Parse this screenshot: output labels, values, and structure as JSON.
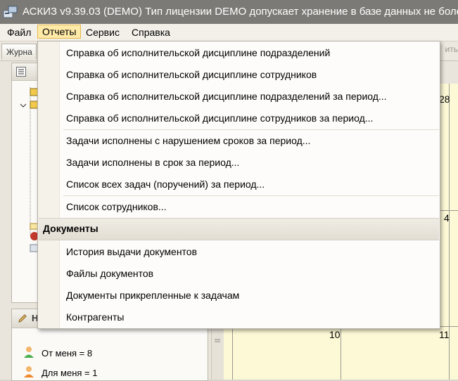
{
  "window": {
    "title": "АСКИЗ v9.39.03 (DEMO) Тип лицензии DEMO допускает хранение в базе данных не боле"
  },
  "menubar": {
    "items": [
      {
        "label": "Файл"
      },
      {
        "label": "Отчеты"
      },
      {
        "label": "Сервис"
      },
      {
        "label": "Справка"
      }
    ],
    "active": "Отчеты"
  },
  "background": {
    "tab_label": "Журна",
    "right_label": "ить",
    "lower_panel_header": "Н",
    "stats": [
      {
        "label": "От меня = 8"
      },
      {
        "label": "Для меня = 1"
      }
    ],
    "calendar_numbers": [
      "28",
      "4",
      "10",
      "11"
    ]
  },
  "dropdown": {
    "group1": [
      {
        "label": "Справка об исполнительской дисциплине подразделений"
      },
      {
        "label": "Справка об исполнительской дисциплине сотрудников"
      },
      {
        "label": "Справка об исполнительской дисциплине подразделений за период..."
      },
      {
        "label": "Справка об исполнительской дисциплине сотрудников за период..."
      }
    ],
    "group2": [
      {
        "label": "Задачи исполнены с нарушением сроков за период..."
      },
      {
        "label": "Задачи исполнены в срок за период..."
      },
      {
        "label": "Список всех задач (поручений) за период..."
      }
    ],
    "group3": [
      {
        "label": "Список сотрудников..."
      }
    ],
    "section_header": "Документы",
    "group4": [
      {
        "label": "История выдачи документов"
      },
      {
        "label": "Файлы документов"
      },
      {
        "label": "Документы прикрепленные к задачам"
      },
      {
        "label": "Контрагенты"
      }
    ]
  },
  "colors": {
    "titlebar": "#7b7a76",
    "menu_highlight": "#ffeaa8",
    "calendar_bg": "#fdf9d6"
  }
}
